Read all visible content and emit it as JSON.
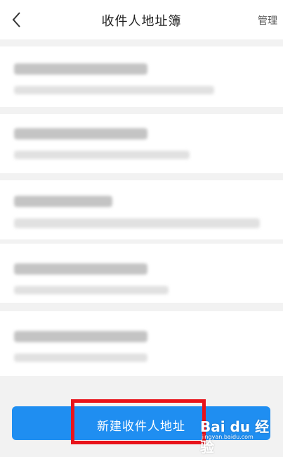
{
  "header": {
    "title": "收件人地址簿",
    "manage_label": "管理"
  },
  "addresses": [
    {
      "name": "",
      "address": ""
    },
    {
      "name": "",
      "address": ""
    },
    {
      "name": "",
      "address": ""
    },
    {
      "name": "",
      "address": ""
    },
    {
      "name": "",
      "address": ""
    }
  ],
  "footer": {
    "new_address_label": "新建收件人地址"
  },
  "watermark": {
    "logo": "Bai du 经验",
    "url": "jingyan.baidu.com"
  },
  "colors": {
    "accent": "#1f8ef1",
    "highlight": "#e8131b",
    "background": "#f2f2f2"
  }
}
